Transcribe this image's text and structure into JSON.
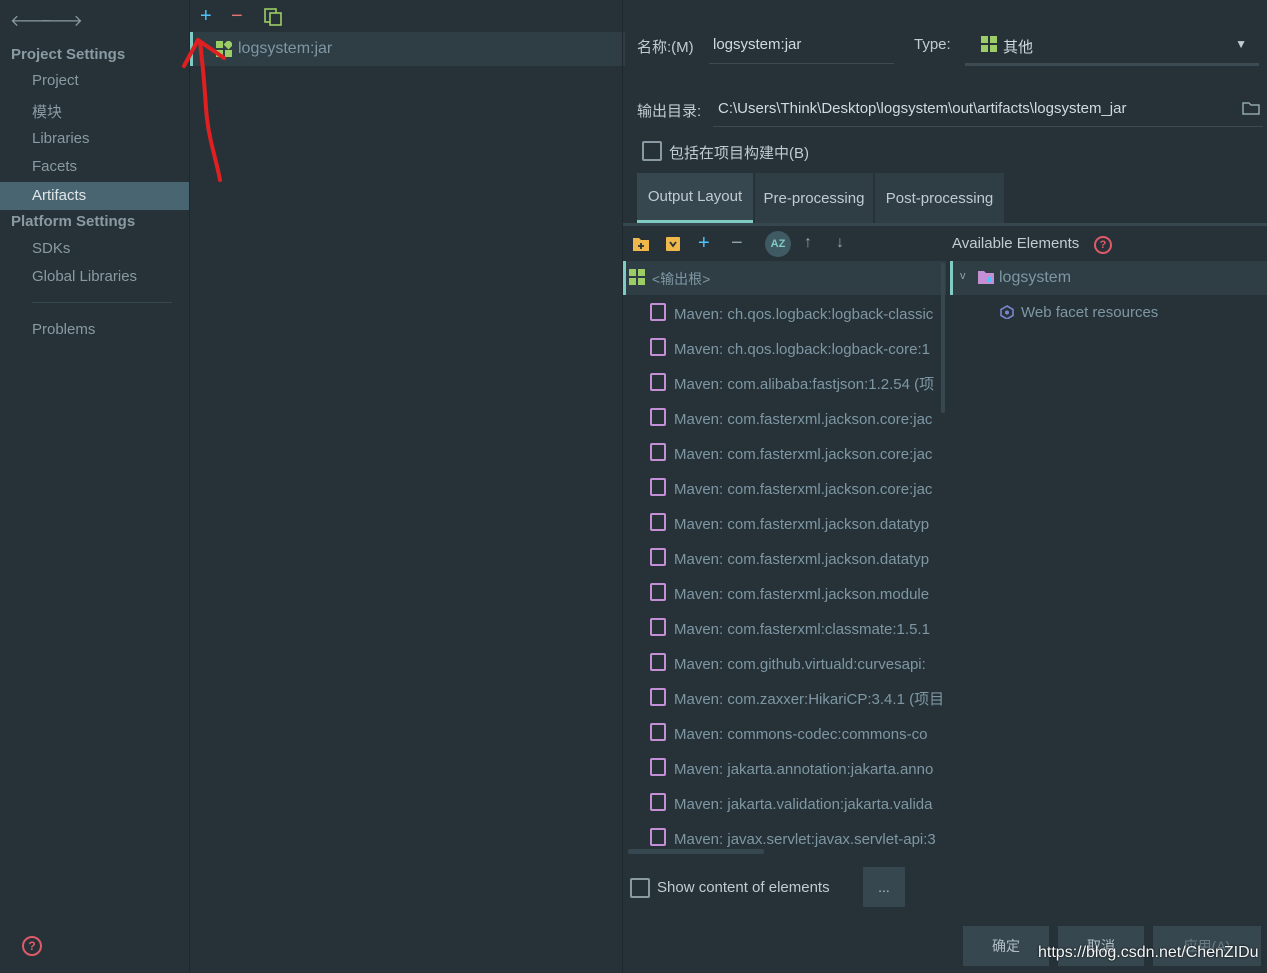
{
  "nav": {
    "back": "🡐",
    "forward": "🡒"
  },
  "sidebar": {
    "project_settings": "Project Settings",
    "items_top": [
      "Project",
      "模块",
      "Libraries",
      "Facets",
      "Artifacts"
    ],
    "platform_settings": "Platform Settings",
    "items_platform": [
      "SDKs",
      "Global Libraries"
    ],
    "problems": "Problems"
  },
  "toolbar": {
    "add": "+",
    "remove": "−"
  },
  "artifacts_list": {
    "selected": "logsystem:jar"
  },
  "form": {
    "name_label": "名称:(M)",
    "name_value": "logsystem:jar",
    "type_label": "Type:",
    "type_value": "其他",
    "output_dir_label": "输出目录:",
    "output_dir_value": "C:\\Users\\Think\\Desktop\\logsystem\\out\\artifacts\\logsystem_jar",
    "include_in_build_label": "包括在项目构建中(B)"
  },
  "tabs": [
    "Output Layout",
    "Pre-processing",
    "Post-processing"
  ],
  "layout": {
    "root_label": "<输出根>",
    "entries": [
      "Maven: ch.qos.logback:logback-classic",
      "Maven: ch.qos.logback:logback-core:1",
      "Maven: com.alibaba:fastjson:1.2.54 (项",
      "Maven: com.fasterxml.jackson.core:jac",
      "Maven: com.fasterxml.jackson.core:jac",
      "Maven: com.fasterxml.jackson.core:jac",
      "Maven: com.fasterxml.jackson.datatyp",
      "Maven: com.fasterxml.jackson.datatyp",
      "Maven: com.fasterxml.jackson.module",
      "Maven: com.fasterxml:classmate:1.5.1",
      "Maven: com.github.virtuald:curvesapi:",
      "Maven: com.zaxxer:HikariCP:3.4.1 (项目",
      "Maven: commons-codec:commons-co",
      "Maven: jakarta.annotation:jakarta.anno",
      "Maven: jakarta.validation:jakarta.valida",
      "Maven: javax.servlet:javax.servlet-api:3"
    ]
  },
  "available": {
    "header": "Available Elements",
    "module": "logsystem",
    "web_facet": "Web facet resources"
  },
  "show_content_label": "Show content of elements",
  "ellipsis": "...",
  "buttons": {
    "ok": "确定",
    "cancel": "取消",
    "apply": "应用(A)"
  },
  "watermark": "https://blog.csdn.net/ChenZIDu",
  "colors": {
    "accent": "#80cbc4",
    "selection": "#4a6572",
    "annotation": "#e02020"
  }
}
